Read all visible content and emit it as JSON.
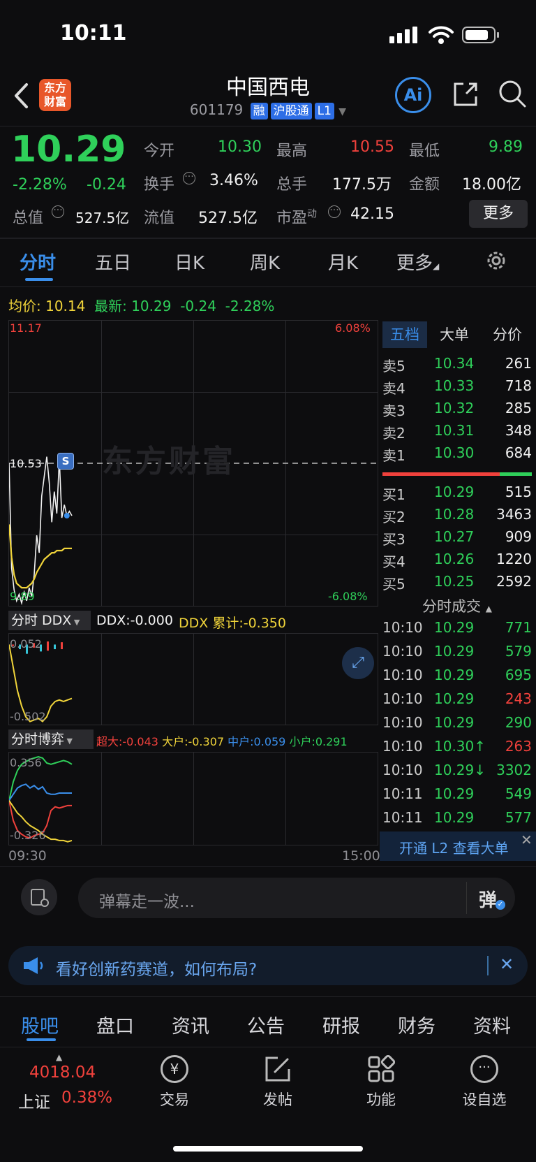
{
  "status_bar": {
    "time": "10:11"
  },
  "header": {
    "logo_text": "东方财富",
    "title": "中国西电",
    "code": "601179",
    "tags": [
      "融",
      "沪股通",
      "L1"
    ],
    "ai_label": "Ai"
  },
  "quote": {
    "price": "10.29",
    "change_pct": "-2.28%",
    "change": "-0.24",
    "open_label": "今开",
    "open": "10.30",
    "high_label": "最高",
    "high": "10.55",
    "low_label": "最低",
    "low": "9.89",
    "turnover_label": "换手",
    "turnover": "3.46%",
    "volume_label": "总手",
    "volume": "177.5万",
    "amount_label": "金额",
    "amount": "18.00亿",
    "mktcap_label": "总值",
    "mktcap": "527.5亿",
    "float_label": "流值",
    "float_cap": "527.5亿",
    "pe_label": "市盈",
    "pe_sup": "动",
    "pe": "42.15",
    "more_label": "更多"
  },
  "chart_tabs": [
    "分时",
    "五日",
    "日K",
    "周K",
    "月K",
    "更多"
  ],
  "avg_line": {
    "avg_label": "均价:",
    "avg": "10.14",
    "latest_label": "最新:",
    "latest": "10.29",
    "change": "-0.24",
    "change_pct": "-2.28%"
  },
  "chart_data": {
    "type": "line",
    "y_top": "11.17",
    "y_bottom": "9.89",
    "y_mid": "10.53",
    "pct_top": "6.08%",
    "pct_bottom": "-6.08%",
    "ylim": [
      9.89,
      11.17
    ],
    "x_start": "09:30",
    "x_end": "15:00",
    "series": [
      {
        "values": [
          10.53,
          10.05,
          9.95,
          9.9,
          9.93,
          9.89,
          9.94,
          9.9,
          9.96,
          9.92,
          10.02,
          10.2,
          10.12,
          10.38,
          10.47,
          10.56,
          10.44,
          10.26,
          10.4,
          10.3,
          10.55,
          10.28,
          10.34,
          10.29,
          10.31,
          10.29
        ]
      },
      {
        "values": [
          10.25,
          10.1,
          10.02,
          9.98,
          9.97,
          9.96,
          9.96,
          9.96,
          9.97,
          9.98,
          10.0,
          10.03,
          10.05,
          10.07,
          10.09,
          10.1,
          10.11,
          10.12,
          10.12,
          10.13,
          10.13,
          10.13,
          10.14,
          10.14,
          10.14,
          10.14
        ]
      }
    ],
    "marker_label": "S",
    "watermark": "东方财富"
  },
  "ddx": {
    "selector": "分时 DDX",
    "ddx_label": "DDX:-0.000",
    "ddx_cum": "DDX 累计:-0.350",
    "y_top": "0.052",
    "y_bottom": "-0.502",
    "line": [
      0.0,
      -0.15,
      -0.3,
      -0.4,
      -0.47,
      -0.5,
      -0.49,
      -0.48,
      -0.5,
      -0.47,
      -0.4,
      -0.37,
      -0.36,
      -0.37,
      -0.36,
      -0.35
    ]
  },
  "game": {
    "selector": "分时博弈",
    "super": "超大:-0.043",
    "large": "大户:-0.307",
    "mid": "中户:0.059",
    "small": "小户:0.291",
    "y_top": "0.356",
    "y_bottom": "-0.326",
    "green": [
      0.0,
      0.15,
      0.24,
      0.29,
      0.31,
      0.33,
      0.34,
      0.35,
      0.34,
      0.3,
      0.29,
      0.3,
      0.31,
      0.32,
      0.31,
      0.29
    ],
    "blue": [
      0.0,
      0.05,
      0.1,
      0.12,
      0.13,
      0.1,
      0.12,
      0.09,
      0.11,
      0.06,
      0.05,
      0.05,
      0.06,
      0.06,
      0.06,
      0.06
    ],
    "red": [
      0.0,
      -0.16,
      -0.24,
      -0.27,
      -0.29,
      -0.3,
      -0.28,
      -0.27,
      -0.26,
      -0.2,
      -0.08,
      -0.05,
      -0.06,
      -0.05,
      -0.04,
      -0.04
    ],
    "yellow": [
      0.0,
      -0.05,
      -0.1,
      -0.13,
      -0.17,
      -0.2,
      -0.22,
      -0.24,
      -0.27,
      -0.29,
      -0.31,
      -0.31,
      -0.32,
      -0.32,
      -0.33,
      -0.32
    ]
  },
  "orderbook": {
    "tabs": [
      "五档",
      "大单",
      "分价"
    ],
    "asks": [
      {
        "label": "卖5",
        "price": "10.34",
        "vol": "261"
      },
      {
        "label": "卖4",
        "price": "10.33",
        "vol": "718"
      },
      {
        "label": "卖3",
        "price": "10.32",
        "vol": "285"
      },
      {
        "label": "卖2",
        "price": "10.31",
        "vol": "348"
      },
      {
        "label": "卖1",
        "price": "10.30",
        "vol": "684"
      }
    ],
    "bids": [
      {
        "label": "买1",
        "price": "10.29",
        "vol": "515"
      },
      {
        "label": "买2",
        "price": "10.28",
        "vol": "3463"
      },
      {
        "label": "买3",
        "price": "10.27",
        "vol": "909"
      },
      {
        "label": "买4",
        "price": "10.26",
        "vol": "1220"
      },
      {
        "label": "买5",
        "price": "10.25",
        "vol": "2592"
      }
    ],
    "trades_title": "分时成交",
    "trades": [
      {
        "time": "10:10",
        "price": "10.29",
        "vol": "771",
        "color": "green"
      },
      {
        "time": "10:10",
        "price": "10.29",
        "vol": "579",
        "color": "green"
      },
      {
        "time": "10:10",
        "price": "10.29",
        "vol": "695",
        "color": "green"
      },
      {
        "time": "10:10",
        "price": "10.29",
        "vol": "243",
        "color": "red"
      },
      {
        "time": "10:10",
        "price": "10.29",
        "vol": "290",
        "color": "green"
      },
      {
        "time": "10:10",
        "price": "10.30↑",
        "vol": "263",
        "color": "red"
      },
      {
        "time": "10:10",
        "price": "10.29↓",
        "vol": "3302",
        "color": "green"
      },
      {
        "time": "10:11",
        "price": "10.29",
        "vol": "549",
        "color": "green"
      },
      {
        "time": "10:11",
        "price": "10.29",
        "vol": "577",
        "color": "green"
      }
    ],
    "l2_banner": "开通 L2 查看大单"
  },
  "comment": {
    "placeholder": "弹幕走一波...",
    "send_label": "弹"
  },
  "notice": {
    "text": "看好创新药赛道，如何布局?"
  },
  "bottom_tabs": [
    "股吧",
    "盘口",
    "资讯",
    "公告",
    "研报",
    "财务",
    "资料"
  ],
  "nav": {
    "index_value": "4018.04",
    "index_name": "上证",
    "index_change": "0.38%",
    "trade": "交易",
    "post": "发帖",
    "function": "功能",
    "watchlist": "设自选"
  }
}
